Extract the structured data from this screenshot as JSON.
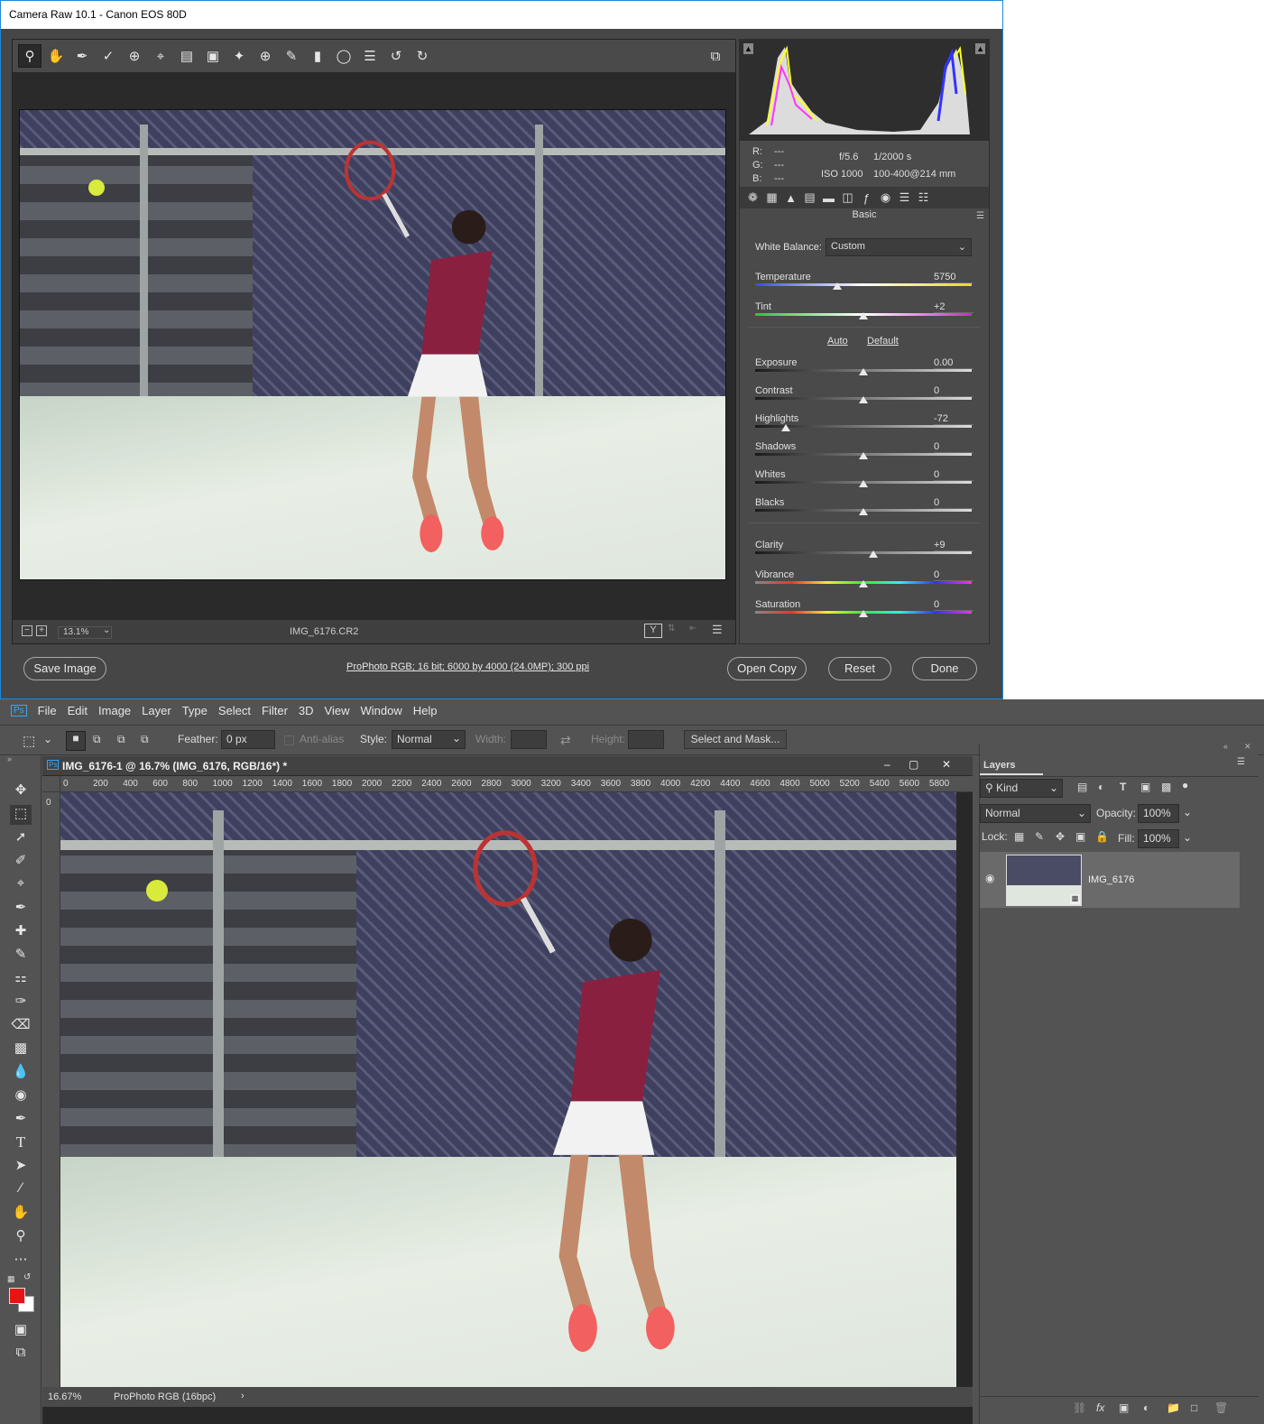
{
  "acr": {
    "title": "Camera Raw 10.1  -  Canon EOS 80D",
    "zoom": "13.1%",
    "filename": "IMG_6176.CR2",
    "histogram": {
      "r": "R:",
      "g": "G:",
      "b": "B:",
      "r_val": "---",
      "g_val": "---",
      "b_val": "---",
      "aperture": "f/5.6",
      "shutter": "1/2000 s",
      "iso": "ISO 1000",
      "lens": "100-400@214 mm"
    },
    "panel_name": "Basic",
    "white_balance_label": "White Balance:",
    "white_balance_value": "Custom",
    "auto_label": "Auto",
    "default_label": "Default",
    "sliders": [
      {
        "label": "Temperature",
        "value": "5750",
        "pos": 0.38
      },
      {
        "label": "Tint",
        "value": "+2",
        "pos": 0.5
      },
      {
        "label": "Exposure",
        "value": "0.00",
        "pos": 0.5
      },
      {
        "label": "Contrast",
        "value": "0",
        "pos": 0.5
      },
      {
        "label": "Highlights",
        "value": "-72",
        "pos": 0.14
      },
      {
        "label": "Shadows",
        "value": "0",
        "pos": 0.5
      },
      {
        "label": "Whites",
        "value": "0",
        "pos": 0.5
      },
      {
        "label": "Blacks",
        "value": "0",
        "pos": 0.5
      },
      {
        "label": "Clarity",
        "value": "+9",
        "pos": 0.545
      },
      {
        "label": "Vibrance",
        "value": "0",
        "pos": 0.5
      },
      {
        "label": "Saturation",
        "value": "0",
        "pos": 0.5
      }
    ],
    "buttons": {
      "save": "Save Image",
      "workflow": "ProPhoto RGB; 16 bit; 6000 by 4000 (24.0MP); 300 ppi",
      "open_copy": "Open Copy",
      "reset": "Reset",
      "done": "Done"
    }
  },
  "ps": {
    "logo": "Ps",
    "menu": [
      "File",
      "Edit",
      "Image",
      "Layer",
      "Type",
      "Select",
      "Filter",
      "3D",
      "View",
      "Window",
      "Help"
    ],
    "options": {
      "feather_label": "Feather:",
      "feather_value": "0 px",
      "antialias": "Anti-alias",
      "style_label": "Style:",
      "style_value": "Normal",
      "width_label": "Width:",
      "height_label": "Height:",
      "select_mask": "Select and Mask..."
    },
    "doc_title": "IMG_6176-1 @ 16.7% (IMG_6176, RGB/16*) *",
    "ruler_ticks": [
      "0",
      "200",
      "400",
      "600",
      "800",
      "1000",
      "1200",
      "1400",
      "1600",
      "1800",
      "2000",
      "2200",
      "2400",
      "2600",
      "2800",
      "3000",
      "3200",
      "3400",
      "3600",
      "3800",
      "4000",
      "4200",
      "4400",
      "4600",
      "4800",
      "5000",
      "5200",
      "5400",
      "5600",
      "5800"
    ],
    "vruler_first": "0",
    "status_zoom": "16.67%",
    "status_profile": "ProPhoto RGB (16bpc)",
    "layers": {
      "title": "Layers",
      "kind": "Kind",
      "blend": "Normal",
      "opacity_label": "Opacity:",
      "opacity": "100%",
      "lock_label": "Lock:",
      "fill_label": "Fill:",
      "fill": "100%",
      "layer_name": "IMG_6176"
    }
  }
}
